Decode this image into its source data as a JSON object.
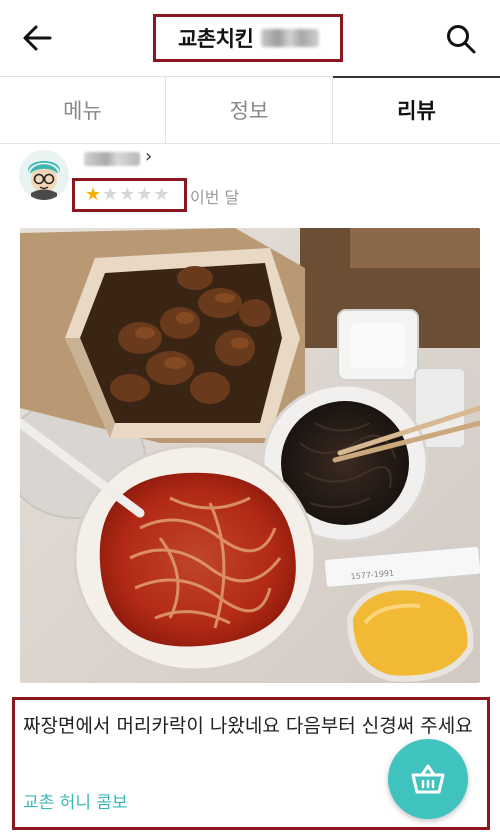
{
  "header": {
    "title": "교촌치킨",
    "back_icon": "arrow-left-icon",
    "search_icon": "search-icon"
  },
  "tabs": [
    {
      "label": "메뉴",
      "active": false
    },
    {
      "label": "정보",
      "active": false
    },
    {
      "label": "리뷰",
      "active": true
    }
  ],
  "review": {
    "rating": 1,
    "max_rating": 5,
    "date": "이번 달",
    "text": "짜장면에서 머리카락이 나왔네요 다음부터 신경써 주세요",
    "menu": "교촌 허니 콤보",
    "photo_receipt_text": "1577-1991"
  },
  "colors": {
    "highlight_border": "#8a1620",
    "accent": "#40c2bf",
    "star_on": "#f5b400",
    "star_off": "#d7d7d7"
  },
  "fab": {
    "icon": "basket-icon"
  }
}
